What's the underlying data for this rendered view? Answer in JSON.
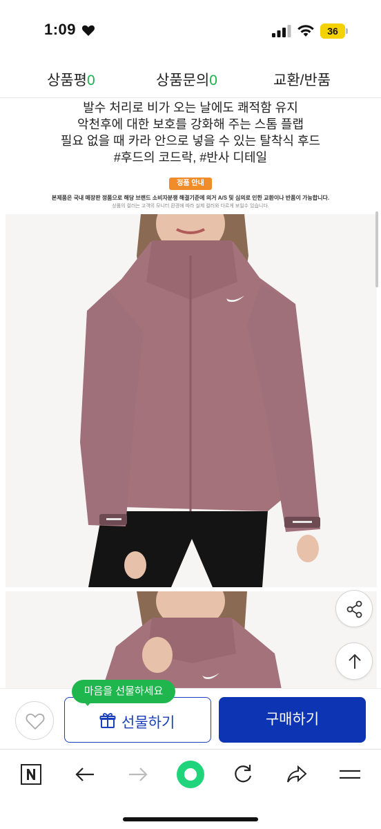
{
  "status_bar": {
    "time": "1:09",
    "battery": "36",
    "icons": [
      "heart-icon",
      "cellular-signal-icon",
      "wifi-icon",
      "battery-icon"
    ]
  },
  "tabs": {
    "reviews_label": "상품평",
    "reviews_count": "0",
    "inquiry_label": "상품문의",
    "inquiry_count": "0",
    "return_label": "교환/반품"
  },
  "description": {
    "lines": [
      "발수 처리로 비가 오는 날에도 쾌적함 유지",
      "악천후에 대한 보호를 강화해 주는 스톰 플랩",
      "필요 없을 때 카라 안으로 넣을 수 있는 탈착식 후드",
      "#후드의 코드락, #반사 디테일"
    ]
  },
  "notice": {
    "badge": "정품 안내",
    "line1": "본제품은 국내 매장판 정품으로 해당 브랜드 소비자분쟁 해결기준에 의거 A/S 및 심의로 인한 교환이나 반품이 가능합니다.",
    "line2": "상품의 컬러는 고객의 모니터 환경에 따라 실제 컬러와 다르게 보일수 있습니다."
  },
  "product": {
    "jacket_color": "#a4727a",
    "pants_color": "#141414"
  },
  "purchase_bar": {
    "tooltip": "마음을 선물하세요",
    "gift_label": "선물하기",
    "buy_label": "구매하기",
    "accent": "#0d35b3",
    "tooltip_color": "#1fb64d"
  },
  "browser_bar": {
    "icons": [
      "naver-n-icon",
      "back-arrow-icon",
      "forward-arrow-icon",
      "home-icon",
      "reload-icon",
      "share-icon",
      "menu-icon"
    ]
  }
}
